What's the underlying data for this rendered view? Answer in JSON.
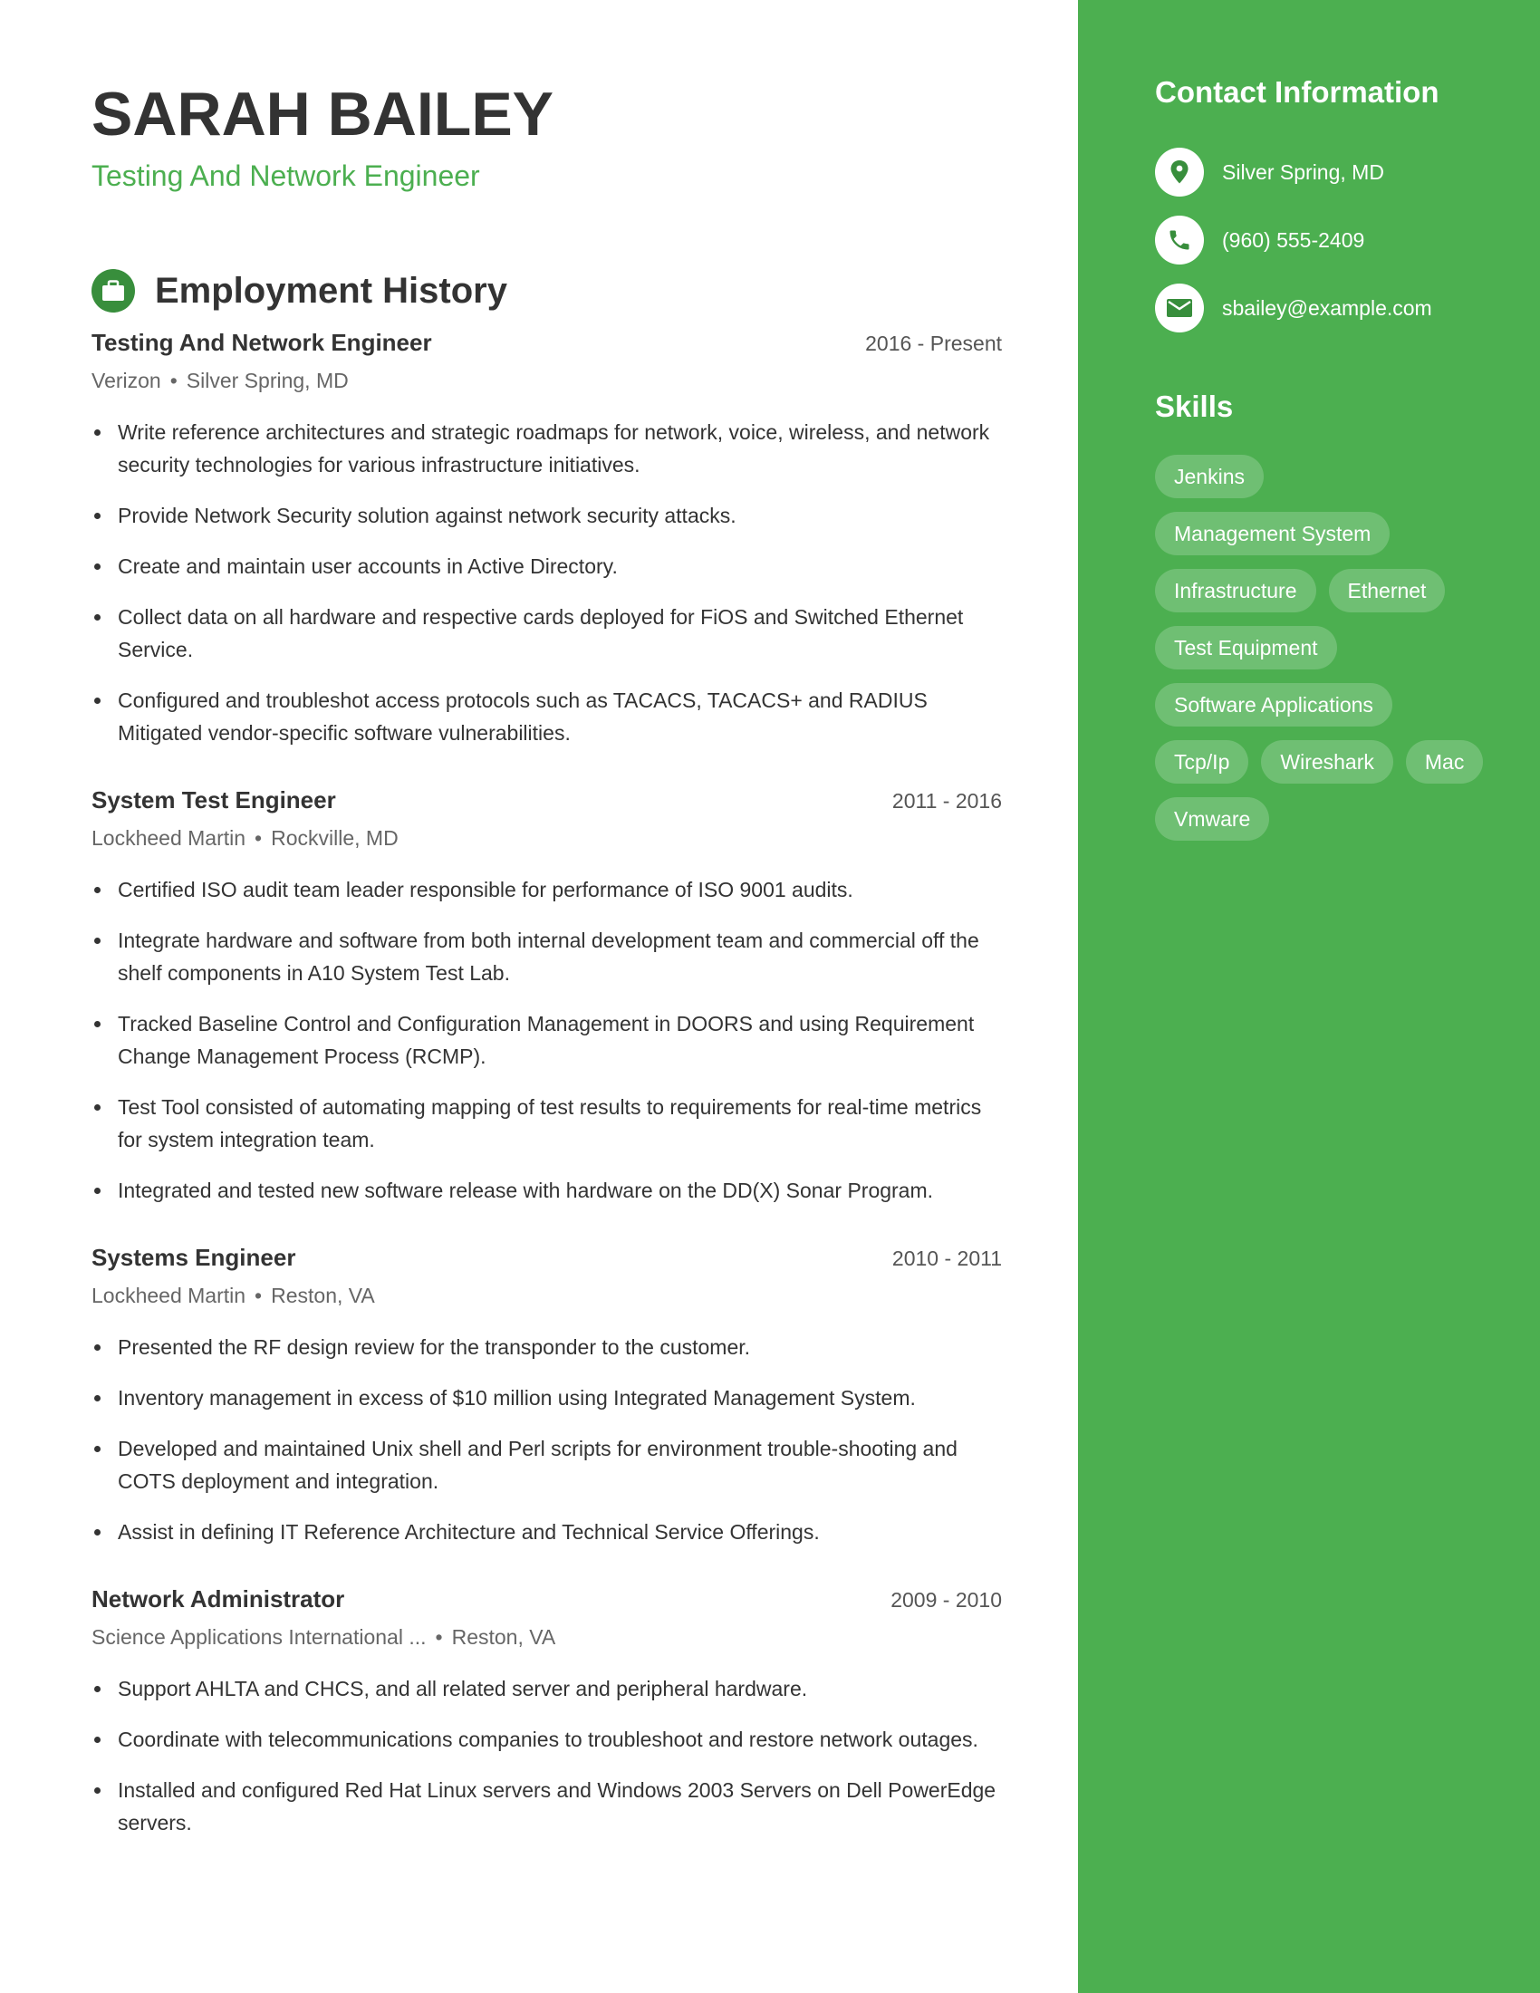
{
  "header": {
    "name": "SARAH BAILEY",
    "headline": "Testing And Network Engineer"
  },
  "employment": {
    "section_title": "Employment History",
    "section_icon": "briefcase-icon",
    "separator": "•",
    "jobs": [
      {
        "title": "Testing And Network Engineer",
        "dates": "2016 - Present",
        "company": "Verizon",
        "location": "Silver Spring, MD",
        "bullets": [
          "Write reference architectures and strategic roadmaps for network, voice, wireless, and network security technologies for various infrastructure initiatives.",
          "Provide Network Security solution against network security attacks.",
          "Create and maintain user accounts in Active Directory.",
          "Collect data on all hardware and respective cards deployed for FiOS and Switched Ethernet Service.",
          "Configured and troubleshot access protocols such as TACACS, TACACS+ and RADIUS Mitigated vendor-specific software vulnerabilities."
        ]
      },
      {
        "title": "System Test Engineer",
        "dates": "2011 - 2016",
        "company": "Lockheed Martin",
        "location": "Rockville, MD",
        "bullets": [
          "Certified ISO audit team leader responsible for performance of ISO 9001 audits.",
          "Integrate hardware and software from both internal development team and commercial off the shelf components in A10 System Test Lab.",
          "Tracked Baseline Control and Configuration Management in DOORS and using Requirement Change Management Process (RCMP).",
          "Test Tool consisted of automating mapping of test results to requirements for real-time metrics for system integration team.",
          "Integrated and tested new software release with hardware on the DD(X) Sonar Program."
        ]
      },
      {
        "title": "Systems Engineer",
        "dates": "2010 - 2011",
        "company": "Lockheed Martin",
        "location": "Reston, VA",
        "bullets": [
          "Presented the RF design review for the transponder to the customer.",
          "Inventory management in excess of $10 million using Integrated Management System.",
          "Developed and maintained Unix shell and Perl scripts for environment trouble-shooting and COTS deployment and integration.",
          "Assist in defining IT Reference Architecture and Technical Service Offerings."
        ]
      },
      {
        "title": "Network Administrator",
        "dates": "2009 - 2010",
        "company": "Science Applications International ...",
        "location": "Reston, VA",
        "bullets": [
          "Support AHLTA and CHCS, and all related server and peripheral hardware.",
          "Coordinate with telecommunications companies to troubleshoot and restore network outages.",
          "Installed and configured Red Hat Linux servers and Windows 2003 Servers on Dell PowerEdge servers."
        ]
      }
    ]
  },
  "sidebar": {
    "contact_title": "Contact Information",
    "contact": [
      {
        "icon": "location-pin-icon",
        "text": "Silver Spring, MD"
      },
      {
        "icon": "phone-icon",
        "text": "(960) 555-2409"
      },
      {
        "icon": "email-icon",
        "text": "sbailey@example.com"
      }
    ],
    "skills_title": "Skills",
    "skills": [
      "Jenkins",
      "Management System",
      "Infrastructure",
      "Ethernet",
      "Test Equipment",
      "Software Applications",
      "Tcp/Ip",
      "Wireshark",
      "Mac",
      "Vmware"
    ]
  },
  "colors": {
    "accent": "#4CAF50",
    "accent_dark": "#388E3C",
    "text": "#333333",
    "muted": "#666666"
  }
}
